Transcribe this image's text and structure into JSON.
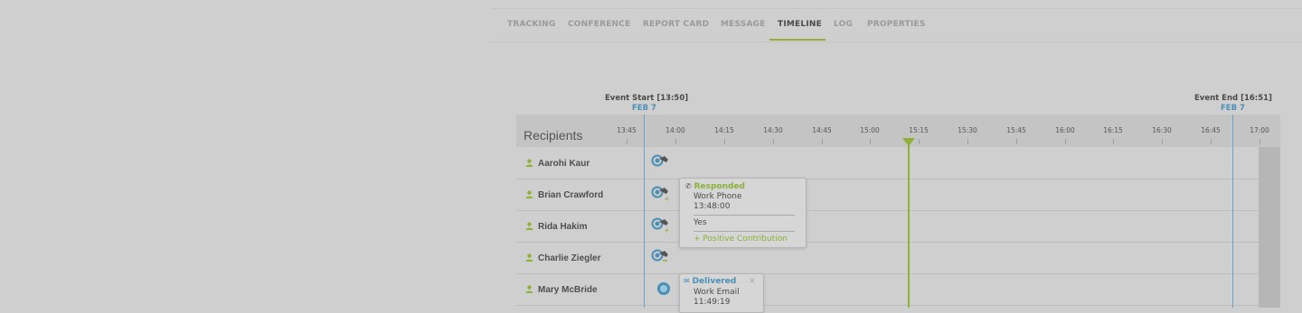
{
  "tabs": [
    {
      "label": "TRACKING",
      "active": false
    },
    {
      "label": "CONFERENCE",
      "active": false
    },
    {
      "label": "REPORT CARD",
      "active": false
    },
    {
      "label": "MESSAGE",
      "active": false
    },
    {
      "label": "TIMELINE",
      "active": true
    },
    {
      "label": "LOG",
      "active": false
    },
    {
      "label": "PROPERTIES",
      "active": false
    }
  ],
  "event_start": {
    "label": "Event Start [13:50]",
    "date": "FEB 7"
  },
  "event_end": {
    "label": "Event End [16:51]",
    "date": "FEB 7"
  },
  "timeline": {
    "recipients_title": "Recipients",
    "ticks": [
      "13:45",
      "14:00",
      "14:15",
      "14:30",
      "14:45",
      "15:00",
      "15:15",
      "15:30",
      "15:45",
      "16:00",
      "16:15",
      "16:30",
      "16:45",
      "17:00"
    ]
  },
  "recipients": [
    {
      "name": "Aarohi Kaur",
      "icon": "phone-responded-icon"
    },
    {
      "name": "Brian Crawford",
      "icon": "phone-responded-positive-icon"
    },
    {
      "name": "Rida Hakim",
      "icon": "phone-responded-positive-icon"
    },
    {
      "name": "Charlie Ziegler",
      "icon": "phone-responded-negative-icon"
    },
    {
      "name": "Mary McBride",
      "icon": "email-delivered-icon"
    }
  ],
  "popup_response": {
    "status": "Responded",
    "channel": "Work Phone",
    "time": "13:48:00",
    "answer": "Yes",
    "contribution": "+ Positive Contribution"
  },
  "popup_delivery": {
    "status": "Delivered",
    "channel": "Work Email",
    "time": "11:49:19",
    "close": "×"
  },
  "colors": {
    "accent_green": "#8fb13a",
    "accent_blue": "#4a8fb5",
    "background": "#cfcfcf"
  }
}
